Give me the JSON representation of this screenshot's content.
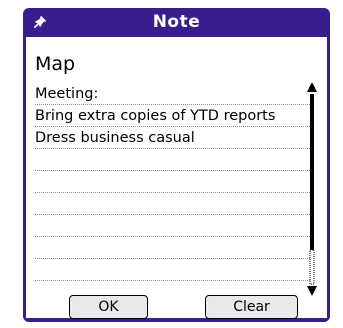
{
  "dialog": {
    "title": "Note",
    "pin_icon": "pushpin-icon"
  },
  "note": {
    "heading": "Map",
    "lines": [
      "Meeting:",
      "Bring extra copies of YTD reports",
      "Dress business casual",
      "",
      "",
      "",
      "",
      "",
      "",
      ""
    ]
  },
  "buttons": {
    "ok_label": "OK",
    "clear_label": "Clear"
  },
  "colors": {
    "frame": "#3a1d8c",
    "button_face": "#e9e9e9"
  }
}
